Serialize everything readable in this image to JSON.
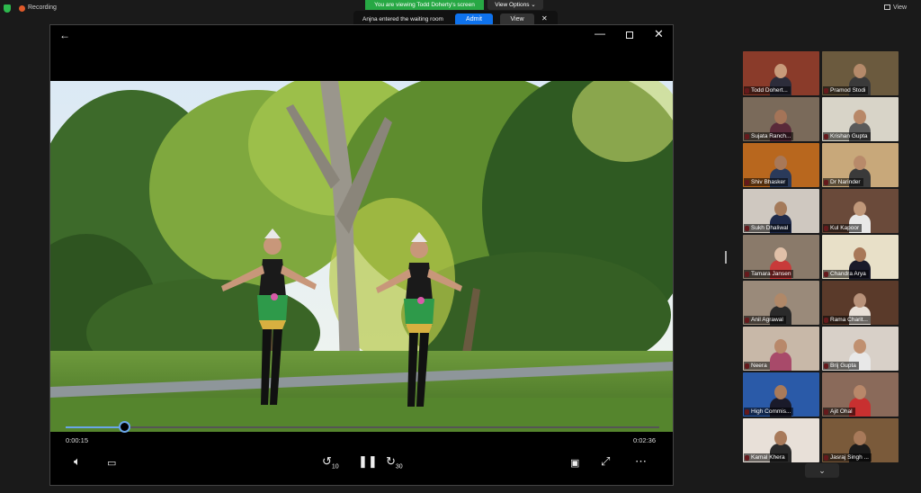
{
  "topbar": {
    "recording_label": "Recording",
    "viewing_banner": "You are viewing Todd Doherty's screen",
    "view_options_label": "View Options",
    "view_label": "View"
  },
  "waiting_room": {
    "message": "Anjna entered the waiting room",
    "admit_label": "Admit",
    "view_label": "View"
  },
  "player": {
    "current_time": "0:00:15",
    "duration": "0:02:36",
    "progress_fraction": 0.098,
    "rewind_label": "10",
    "forward_label": "30"
  },
  "participants": [
    {
      "name": "Todd Dohert...",
      "bg": "#8a3b2a",
      "skin": "#c89b7b",
      "shirt": "#2c2c3a"
    },
    {
      "name": "Pramod Stodi",
      "bg": "#6b5a3e",
      "skin": "#b58a6a",
      "shirt": "#3a3a3a"
    },
    {
      "name": "Sujata Ranch...",
      "bg": "#7a6a5a",
      "skin": "#a47458",
      "shirt": "#5a2a3a"
    },
    {
      "name": "Krishan Gupta",
      "bg": "#d8d4c8",
      "skin": "#b88868",
      "shirt": "#5a5a5a"
    },
    {
      "name": "Shiv Bhasker",
      "bg": "#b8671e",
      "skin": "#a87858",
      "shirt": "#2a3a5a"
    },
    {
      "name": "Dr Narinder",
      "bg": "#c8a87a",
      "skin": "#b88a6a",
      "shirt": "#3a3a3a"
    },
    {
      "name": "Sukh Dhaliwal",
      "bg": "#cfc8c0",
      "skin": "#a47a5a",
      "shirt": "#1e2a4a"
    },
    {
      "name": "Kul Kapoor",
      "bg": "#6a4a3a",
      "skin": "#c0987a",
      "shirt": "#e8e8e8"
    },
    {
      "name": "Tamara Jansen",
      "bg": "#8a7a6a",
      "skin": "#e0c0a8",
      "shirt": "#c83a3a"
    },
    {
      "name": "Chandra Arya",
      "bg": "#e8e0c8",
      "skin": "#a87858",
      "shirt": "#1a1a2a"
    },
    {
      "name": "Anil Agrawal",
      "bg": "#9a8a7a",
      "skin": "#b08868",
      "shirt": "#2a2a2a"
    },
    {
      "name": "Rama Charit...",
      "bg": "#5a3a2a",
      "skin": "#b8927a",
      "shirt": "#e8e0d8"
    },
    {
      "name": "Neera",
      "bg": "#c8b8a8",
      "skin": "#b8886a",
      "shirt": "#a84a6a"
    },
    {
      "name": "Brij Gupta",
      "bg": "#d8d0c8",
      "skin": "#c09070",
      "shirt": "#e8e8e8"
    },
    {
      "name": "High Commis...",
      "bg": "#2a5aa8",
      "skin": "#a87a5a",
      "shirt": "#1a1a2a"
    },
    {
      "name": "Ajit Ohal",
      "bg": "#8a6a5a",
      "skin": "#b8886a",
      "shirt": "#c83030"
    },
    {
      "name": "Kamal Khera",
      "bg": "#e8e0d8",
      "skin": "#a87a5a",
      "shirt": "#2a2a2a"
    },
    {
      "name": "Jasraj Singh ...",
      "bg": "#7a5a3a",
      "skin": "#a87a5a",
      "shirt": "#1a1a1a"
    }
  ],
  "colors": {
    "accent_green": "#27a844",
    "admit_blue": "#0e72ed",
    "progress_blue": "#6aa5e8",
    "mute_red": "#e0393e"
  }
}
